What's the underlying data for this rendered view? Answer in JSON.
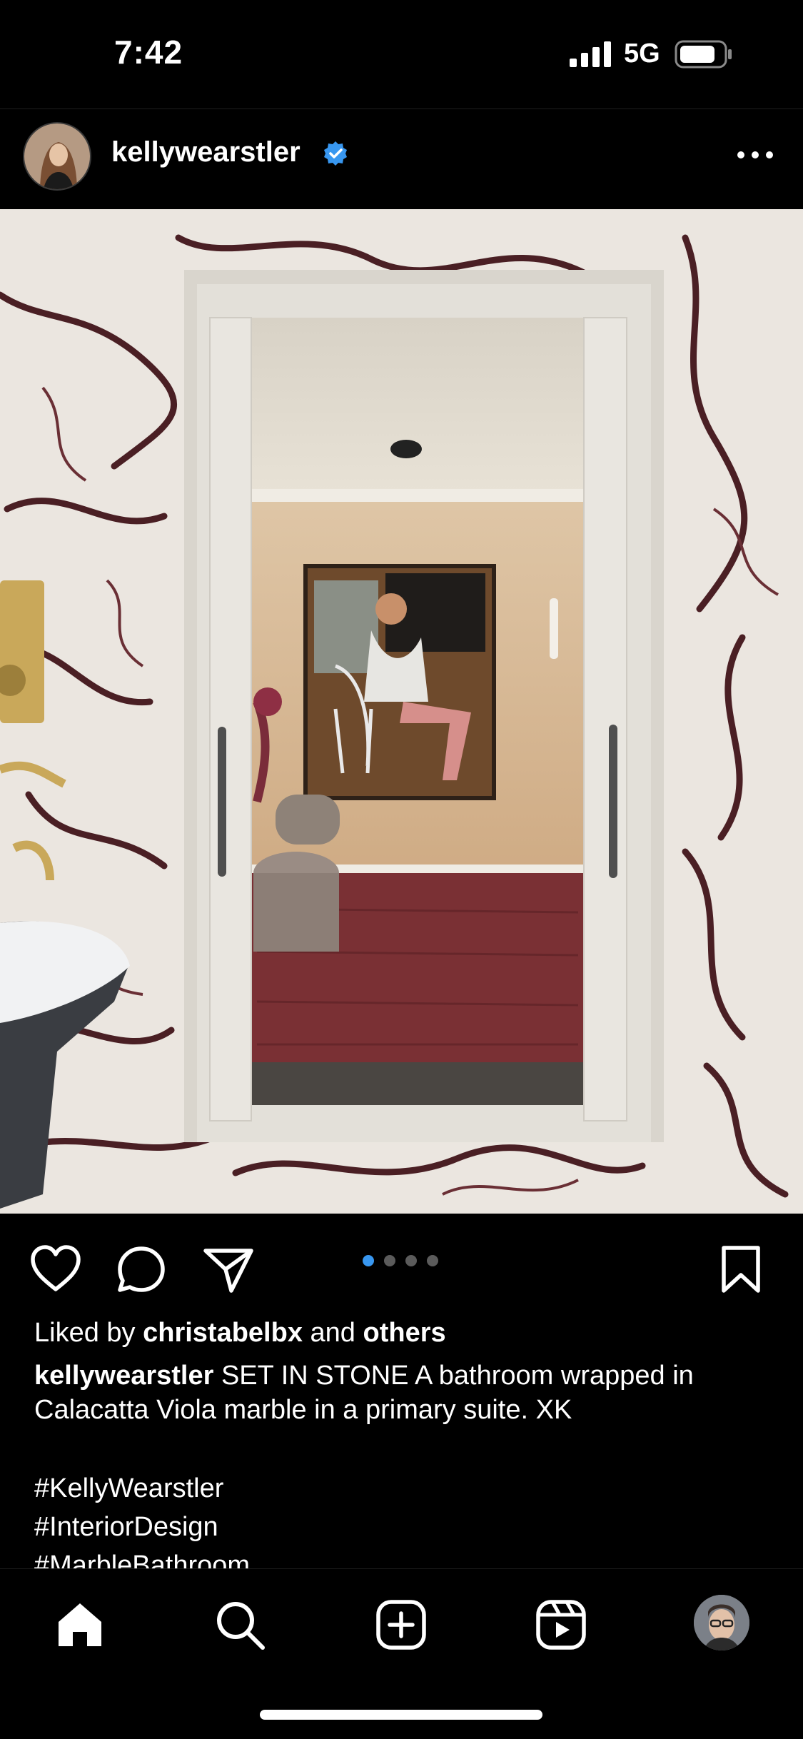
{
  "status_bar": {
    "time": "7:42",
    "network": "5G"
  },
  "post": {
    "username": "kellywearstler",
    "verified": true,
    "photo_alt": "",
    "carousel": {
      "total": 4,
      "active_index": 0
    }
  },
  "actions": {
    "like": "heart-icon",
    "comment": "comment-icon",
    "share": "paper-plane-icon",
    "save": "bookmark-icon"
  },
  "caption": {
    "liked_prefix": "Liked by ",
    "liked_user": "christabelbx",
    "liked_mid": " and ",
    "liked_suffix": "others",
    "author": "kellywearstler",
    "text": " SET IN STONE A bathroom wrapped in Calacatta Viola marble in a primary suite. XK",
    "hashtags": [
      "#KellyWearstler",
      "#InteriorDesign",
      "#MarbleBathroom"
    ]
  },
  "bottom_nav": {
    "items": [
      "home-icon",
      "search-icon",
      "create-icon",
      "reels-icon",
      "profile-avatar"
    ]
  },
  "colors": {
    "background": "#000000",
    "accent": "#3897f0",
    "text": "#ffffff"
  }
}
